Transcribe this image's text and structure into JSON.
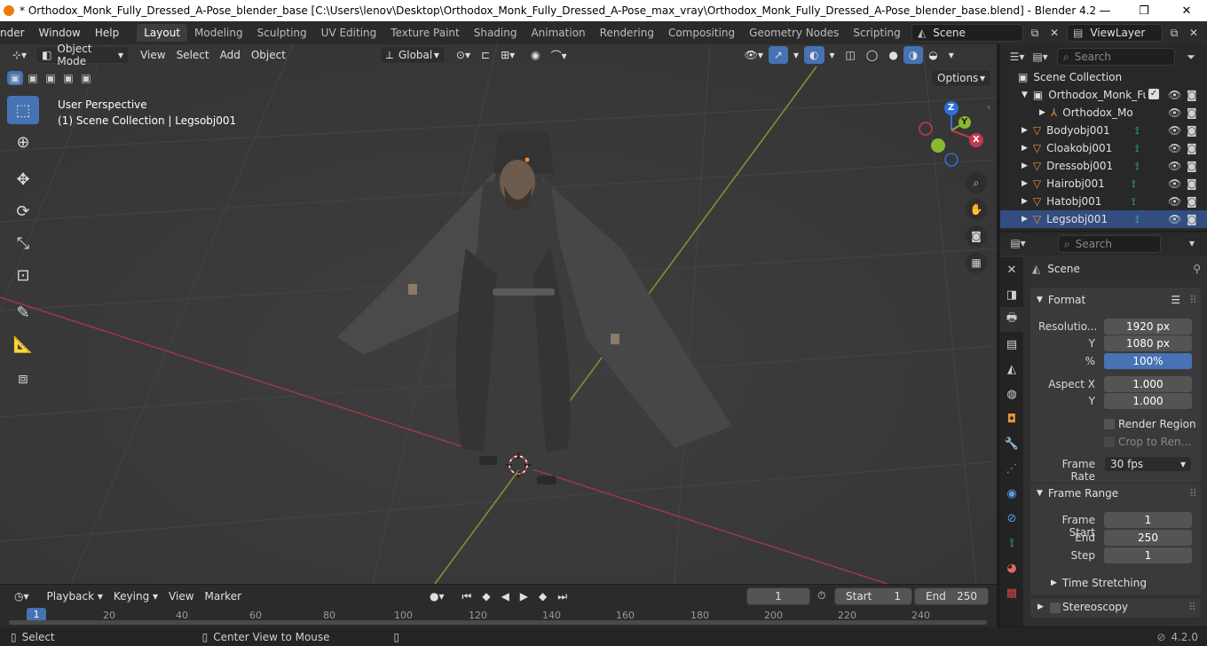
{
  "window": {
    "title": "* Orthodox_Monk_Fully_Dressed_A-Pose_blender_base [C:\\Users\\lenov\\Desktop\\Orthodox_Monk_Fully_Dressed_A-Pose_max_vray\\Orthodox_Monk_Fully_Dressed_A-Pose_blender_base.blend] - Blender 4.2",
    "minimize": "—",
    "maximize": "❐",
    "close": "✕"
  },
  "menu": [
    "nder",
    "Window",
    "Help"
  ],
  "workspaces": [
    "Layout",
    "Modeling",
    "Sculpting",
    "UV Editing",
    "Texture Paint",
    "Shading",
    "Animation",
    "Rendering",
    "Compositing",
    "Geometry Nodes",
    "Scripting"
  ],
  "workspace_add": "+",
  "scene_name": "Scene",
  "view_layer": "ViewLayer",
  "viewport": {
    "mode": "Object Mode",
    "menus": [
      "View",
      "Select",
      "Add",
      "Object"
    ],
    "transform_orientation": "Global",
    "options_label": "Options",
    "perspective": "User Perspective",
    "collection_info": "(1) Scene Collection | Legsobj001",
    "axes": {
      "z": "Z",
      "y": "Y",
      "x": "X"
    }
  },
  "outliner": {
    "search_placeholder": "Search",
    "root": "Scene Collection",
    "items": [
      {
        "name": "Orthodox_Monk_Fu",
        "type": "collection"
      },
      {
        "name": "Orthodox_Monl",
        "type": "armature"
      },
      {
        "name": "Bodyobj001",
        "type": "mesh"
      },
      {
        "name": "Cloakobj001",
        "type": "mesh"
      },
      {
        "name": "Dressobj001",
        "type": "mesh"
      },
      {
        "name": "Hairobj001",
        "type": "mesh"
      },
      {
        "name": "Hatobj001",
        "type": "mesh"
      },
      {
        "name": "Legsobj001",
        "type": "mesh"
      }
    ]
  },
  "properties": {
    "search_placeholder": "Search",
    "context": "Scene",
    "format": {
      "title": "Format",
      "resolution_label": "Resolutio...",
      "res_x": "1920 px",
      "y_label": "Y",
      "res_y": "1080 px",
      "pct_label": "%",
      "res_pct": "100%",
      "aspect_x_label": "Aspect X",
      "aspect_x": "1.000",
      "aspect_y_label": "Y",
      "aspect_y": "1.000",
      "render_region": "Render Region",
      "crop": "Crop to Ren...",
      "frame_rate_label": "Frame Rate",
      "frame_rate": "30 fps"
    },
    "frame_range": {
      "title": "Frame Range",
      "start_label": "Frame Start",
      "start": "1",
      "end_label": "End",
      "end": "250",
      "step_label": "Step",
      "step": "1"
    },
    "time_stretching": "Time Stretching",
    "stereoscopy": "Stereoscopy"
  },
  "timeline": {
    "menus": [
      "Playback",
      "Keying",
      "View",
      "Marker"
    ],
    "current_frame": "1",
    "start_label": "Start",
    "start": "1",
    "end_label": "End",
    "end": "250",
    "ruler": [
      "1",
      "20",
      "40",
      "60",
      "80",
      "100",
      "120",
      "140",
      "160",
      "180",
      "200",
      "220",
      "240"
    ]
  },
  "status": {
    "select": "Select",
    "center": "Center View to Mouse",
    "version": "4.2.0"
  },
  "colors": {
    "accent": "#4772b3",
    "axis_x": "#c4394a",
    "axis_y": "#8ab832",
    "axis_z": "#2f6fd6",
    "mesh_icon": "#3ec7a8",
    "object_icon": "#e8923a"
  }
}
